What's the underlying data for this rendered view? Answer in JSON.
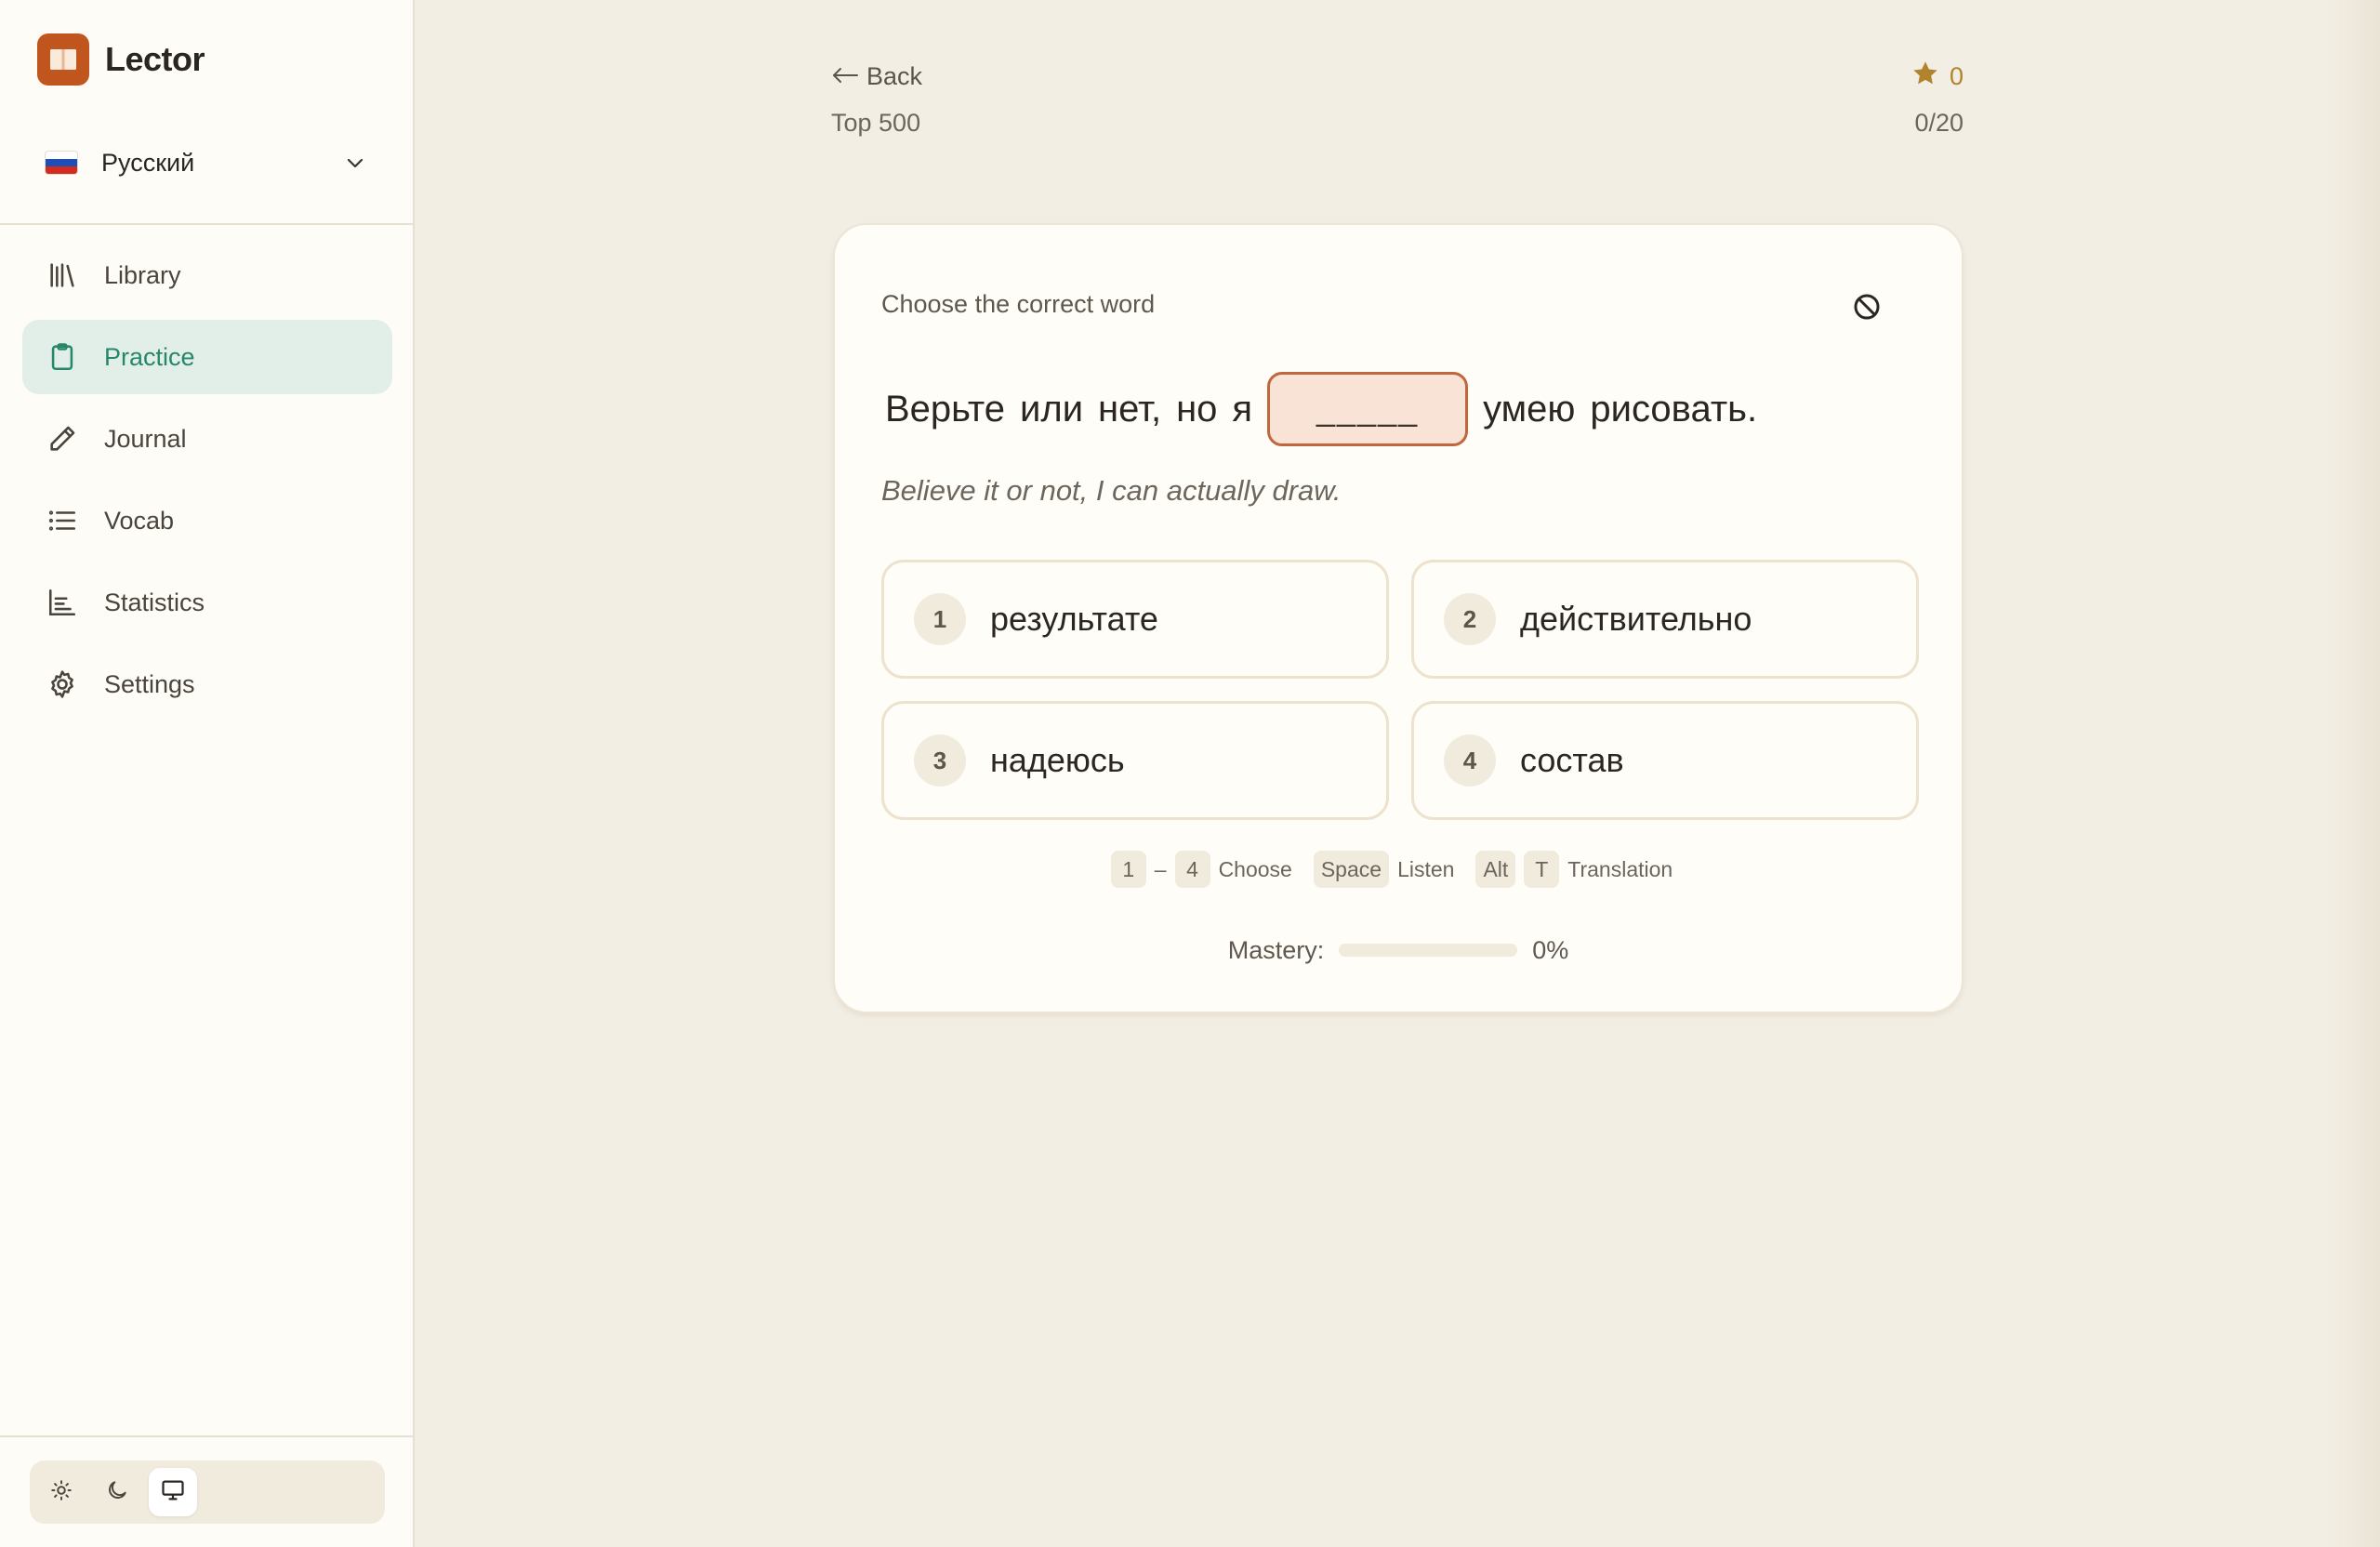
{
  "app": {
    "name": "Lector",
    "accent": "#27876a",
    "brand_color": "#c0561e"
  },
  "language": {
    "selected": "Русский",
    "flag": "ru-flag-icon"
  },
  "nav": [
    {
      "label": "Library",
      "icon": "library-icon",
      "active": false
    },
    {
      "label": "Practice",
      "icon": "clipboard-icon",
      "active": true
    },
    {
      "label": "Journal",
      "icon": "pencil-icon",
      "active": false
    },
    {
      "label": "Vocab",
      "icon": "list-icon",
      "active": false
    },
    {
      "label": "Statistics",
      "icon": "bar-chart-icon",
      "active": false
    },
    {
      "label": "Settings",
      "icon": "gear-icon",
      "active": false
    }
  ],
  "theme": {
    "options": [
      "sun-icon",
      "moon-icon",
      "monitor-icon"
    ],
    "selected": "monitor-icon"
  },
  "header": {
    "back_label": "Back",
    "deck": "Top 500",
    "stars": "0",
    "progress": "0/20"
  },
  "exercise": {
    "prompt": "Choose the correct word",
    "sentence_before": [
      "Верьте",
      "или",
      "нет,",
      "но",
      "я"
    ],
    "blank": "_____",
    "sentence_after": [
      "умею",
      "рисовать."
    ],
    "translation": "Believe it or not, I can actually draw.",
    "options": [
      {
        "num": "1",
        "word": "результате"
      },
      {
        "num": "2",
        "word": "действительно"
      },
      {
        "num": "3",
        "word": "надеюсь"
      },
      {
        "num": "4",
        "word": "состав"
      }
    ]
  },
  "shortcuts": {
    "choose_from": "1",
    "choose_dash": "–",
    "choose_to": "4",
    "choose_label": "Choose",
    "listen_key": "Space",
    "listen_label": "Listen",
    "translate_key1": "Alt",
    "translate_key2": "T",
    "translate_label": "Translation"
  },
  "mastery": {
    "label": "Mastery:",
    "value": "0%",
    "fraction": 0
  }
}
